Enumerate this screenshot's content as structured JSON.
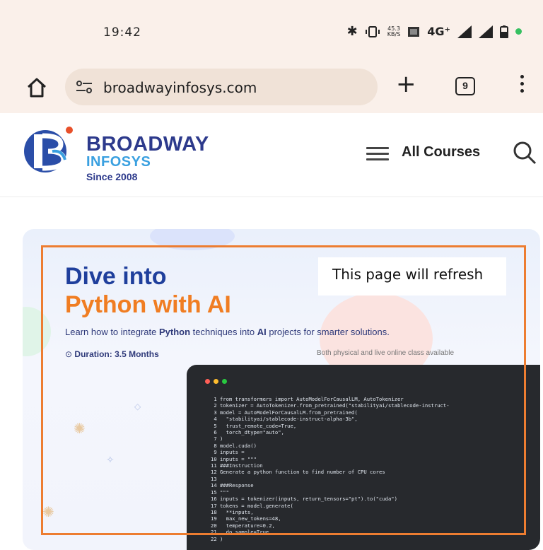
{
  "status_bar": {
    "time": "19:42",
    "bluetooth_icon": "bluetooth-icon",
    "vibrate_icon": "vibrate-icon",
    "net_speed_value": "45.3",
    "net_speed_unit": "KB/S",
    "network": "4G⁺",
    "signal_icons": [
      "signal-icon",
      "signal-icon"
    ],
    "battery_icon": "battery-icon",
    "indicator_color": "#36c061"
  },
  "browser": {
    "url": "broadwayinfosys.com",
    "tab_count": "9"
  },
  "site_header": {
    "brand_line1": "BROADWAY",
    "brand_line2": "INFOSYS",
    "brand_line3": "Since 2008",
    "menu_label": "All Courses",
    "brand_color": "#2d3a8c",
    "accent_color": "#3aa0e0"
  },
  "banner": {
    "headline_line1": "Dive into",
    "headline_line2": "Python with AI",
    "description_pre": "Learn how to integrate ",
    "description_bold": "Python",
    "description_post": " techniques into ",
    "description_bold2": "AI",
    "description_end": " projects for smarter solutions.",
    "duration": "Duration: 3.5 Months",
    "class_modes": "Both physical and live online class available",
    "headline_color_1": "#1f3f9c",
    "headline_color_2": "#f07d22",
    "code_lines": [
      " 1 from transformers import AutoModelForCausalLM, AutoTokenizer",
      " 2 tokenizer = AutoTokenizer.from_pretrained(\"stabilityai/stablecode-instruct-",
      " 3 model = AutoModelForCausalLM.from_pretrained(",
      " 4   \"stabilityai/stablecode-instruct-alpha-3b\",",
      " 5   trust_remote_code=True,",
      " 6   torch_dtype=\"auto\",",
      " 7 )",
      " 8 model.cuda()",
      " 9 inputs =",
      "10 inputs = \"\"\"",
      "11 ###Instruction",
      "12 Generate a python function to find number of CPU cores",
      "13",
      "14 ###Response",
      "15 \"\"\"",
      "16 inputs = tokenizer(inputs, return_tensors=\"pt\").to(\"cuda\")",
      "17 tokens = model.generate(",
      "18   **inputs,",
      "19   max_new_tokens=48,",
      "20   temperature=0.2,",
      "21   do_sample=True,",
      "22 )"
    ]
  },
  "overlay": {
    "message": "This page will refresh",
    "border_color": "#ed7d31"
  }
}
